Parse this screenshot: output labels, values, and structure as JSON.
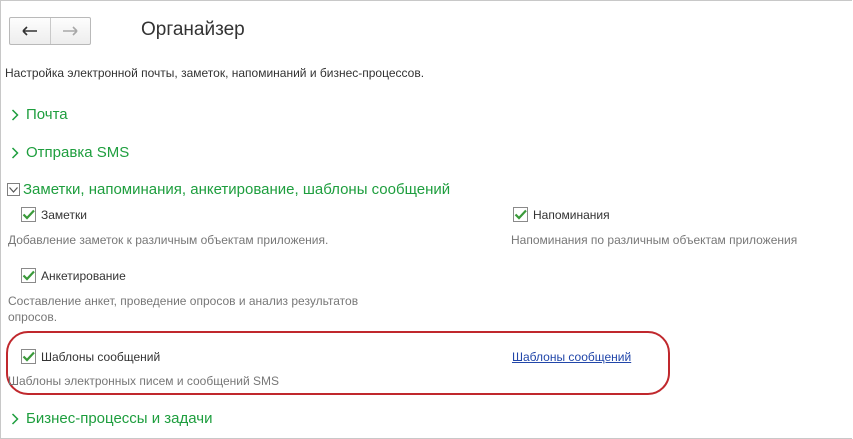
{
  "toolbar": {
    "back_icon": "arrow-left-icon",
    "forward_icon": "arrow-right-icon"
  },
  "page": {
    "title": "Органайзер",
    "subtitle": "Настройка электронной почты, заметок, напоминаний и бизнес-процессов."
  },
  "sections": {
    "mail": {
      "label": "Почта",
      "state": "collapsed"
    },
    "sms": {
      "label": "Отправка SMS",
      "state": "collapsed"
    },
    "notes": {
      "label": "Заметки, напоминания, анкетирование, шаблоны сообщений",
      "state": "expanded"
    },
    "bp": {
      "label": "Бизнес-процессы и задачи",
      "state": "collapsed"
    }
  },
  "options": {
    "notes": {
      "label": "Заметки",
      "checked": true,
      "desc": "Добавление заметок к различным объектам приложения."
    },
    "reminders": {
      "label": "Напоминания",
      "checked": true,
      "desc": "Напоминания по различным объектам приложения"
    },
    "survey": {
      "label": "Анкетирование",
      "checked": true,
      "desc_line1": "Составление анкет, проведение опросов и анализ результатов",
      "desc_line2": "опросов."
    },
    "templates": {
      "label": "Шаблоны сообщений",
      "checked": true,
      "desc": "Шаблоны электронных писем и сообщений SMS",
      "link": "Шаблоны сообщений"
    }
  },
  "colors": {
    "section_green": "#1e9e3e",
    "check_green": "#3a9a3a",
    "highlight_red": "#c0282d",
    "link_blue": "#2146a9"
  }
}
